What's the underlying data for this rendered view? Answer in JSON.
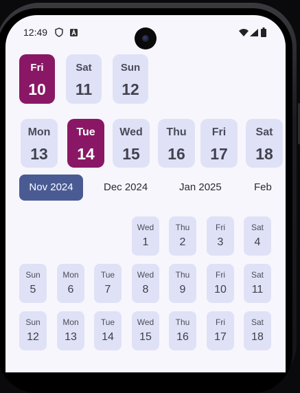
{
  "status_bar": {
    "time": "12:49"
  },
  "week_row_1": [
    {
      "day": "Fri",
      "date": "10",
      "selected": true
    },
    {
      "day": "Sat",
      "date": "11",
      "selected": false
    },
    {
      "day": "Sun",
      "date": "12",
      "selected": false
    }
  ],
  "week_row_2": [
    {
      "day": "Mon",
      "date": "13",
      "selected": false
    },
    {
      "day": "Tue",
      "date": "14",
      "selected": true
    },
    {
      "day": "Wed",
      "date": "15",
      "selected": false
    },
    {
      "day": "Thu",
      "date": "16",
      "selected": false
    },
    {
      "day": "Fri",
      "date": "17",
      "selected": false
    },
    {
      "day": "Sat",
      "date": "18",
      "selected": false
    }
  ],
  "months": [
    {
      "label": "Nov 2024",
      "selected": true
    },
    {
      "label": "Dec 2024",
      "selected": false
    },
    {
      "label": "Jan 2025",
      "selected": false
    },
    {
      "label": "Feb",
      "selected": false
    }
  ],
  "calendar_weeks": [
    [
      null,
      null,
      null,
      {
        "day": "Wed",
        "date": "1"
      },
      {
        "day": "Thu",
        "date": "2"
      },
      {
        "day": "Fri",
        "date": "3"
      },
      {
        "day": "Sat",
        "date": "4"
      }
    ],
    [
      {
        "day": "Sun",
        "date": "5"
      },
      {
        "day": "Mon",
        "date": "6"
      },
      {
        "day": "Tue",
        "date": "7"
      },
      {
        "day": "Wed",
        "date": "8"
      },
      {
        "day": "Thu",
        "date": "9"
      },
      {
        "day": "Fri",
        "date": "10"
      },
      {
        "day": "Sat",
        "date": "11"
      }
    ],
    [
      {
        "day": "Sun",
        "date": "12"
      },
      {
        "day": "Mon",
        "date": "13"
      },
      {
        "day": "Tue",
        "date": "14"
      },
      {
        "day": "Wed",
        "date": "15"
      },
      {
        "day": "Thu",
        "date": "16"
      },
      {
        "day": "Fri",
        "date": "17"
      },
      {
        "day": "Sat",
        "date": "18"
      }
    ]
  ],
  "colors": {
    "selected_day": "#8a1766",
    "selected_month": "#4a5b94",
    "tile": "#dfe2f6",
    "background": "#f8f6fd"
  },
  "icons": [
    "shield-icon",
    "a-letter-icon",
    "wifi-icon",
    "signal-icon",
    "battery-icon",
    "camera-cutout"
  ]
}
